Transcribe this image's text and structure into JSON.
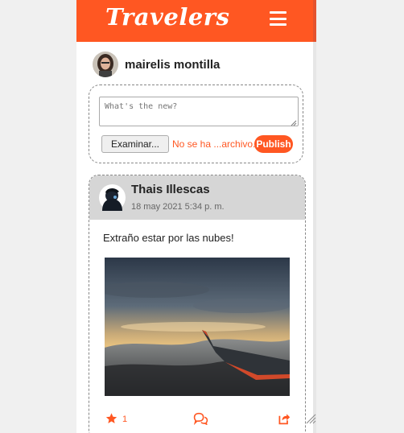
{
  "app": {
    "brand": "Travelers"
  },
  "current_user": {
    "name": "mairelis montilla"
  },
  "composer": {
    "placeholder": "What's the new?",
    "file_button_label": "Examinar...",
    "file_status": "No se ha ...archivo.",
    "publish_label": "Publish"
  },
  "post": {
    "author": "Thais Illescas",
    "date": "18 may 2021 5:34 p. m.",
    "text": "Extraño estar por las nubes!",
    "likes": "1"
  },
  "colors": {
    "accent": "#ff5722",
    "header_bg": "#d6d6d6"
  },
  "icons": {
    "menu": "hamburger-icon",
    "like": "star-icon",
    "comment": "comment-icon",
    "share": "share-icon"
  }
}
